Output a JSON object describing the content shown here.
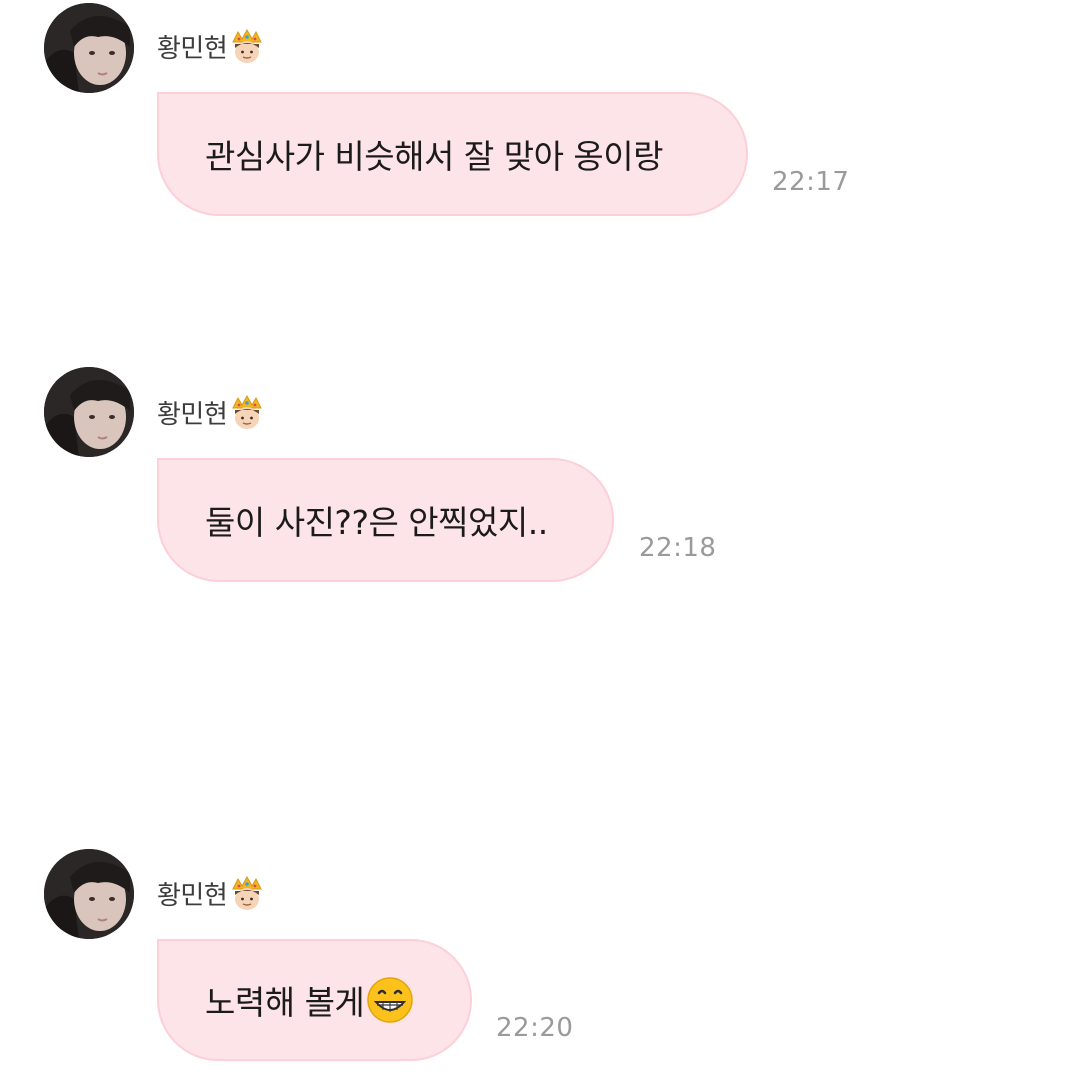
{
  "messages": [
    {
      "sender": "황민현",
      "sender_icon": "crown-prince-emoji",
      "text": "관심사가 비슷해서 잘 맞아 옹이랑",
      "time": "22:17"
    },
    {
      "sender": "황민현",
      "sender_icon": "crown-prince-emoji",
      "text": "둘이 사진??은 안찍었지..",
      "time": "22:18"
    },
    {
      "sender": "황민현",
      "sender_icon": "crown-prince-emoji",
      "text": "노력해 볼게",
      "trailing_emoji": "grinning-face-emoji",
      "time": "22:20"
    }
  ],
  "colors": {
    "bubble_fill": "#fde4e8",
    "bubble_border": "#fbd0d7",
    "time_text": "#9a9a9a",
    "name_text": "#3c3c3c",
    "background": "#ffffff"
  }
}
